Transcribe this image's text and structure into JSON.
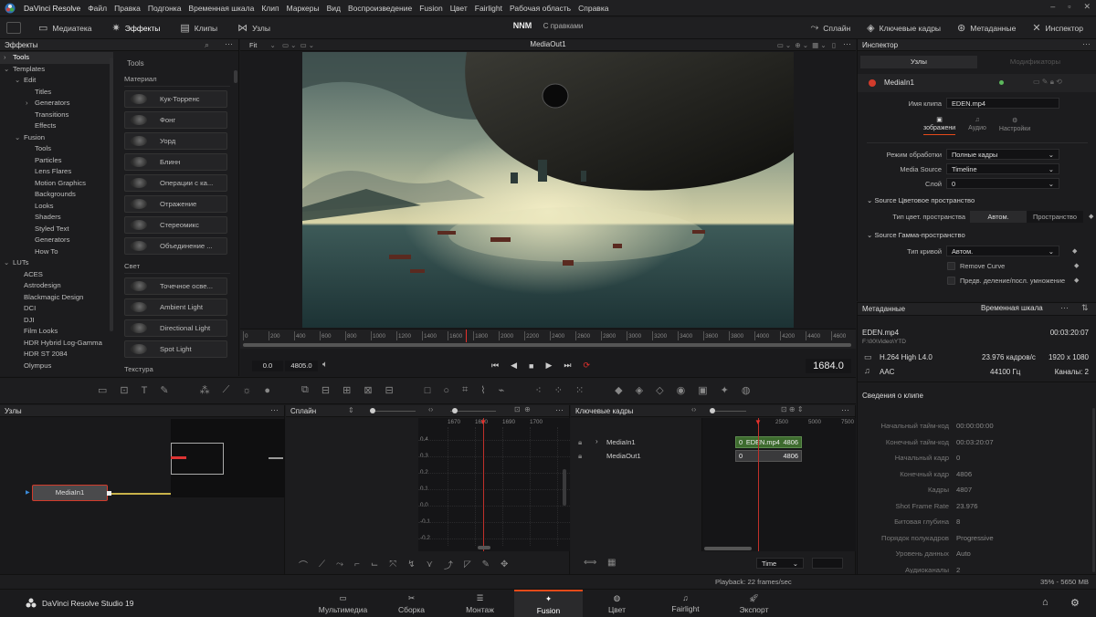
{
  "app": {
    "title": "DaVinci Resolve",
    "logo_icon": "davinci-logo-icon"
  },
  "menu": [
    "Файл",
    "Правка",
    "Подгонка",
    "Временная шкала",
    "Клип",
    "Маркеры",
    "Вид",
    "Воспроизведение",
    "Fusion",
    "Цвет",
    "Fairlight",
    "Рабочая область",
    "Справка"
  ],
  "toolbar": {
    "left": [
      {
        "label": "Медиатека",
        "icon": "media-pool-icon"
      },
      {
        "label": "Эффекты",
        "icon": "effects-icon"
      },
      {
        "label": "Клипы",
        "icon": "clips-icon"
      },
      {
        "label": "Узлы",
        "icon": "nodes-icon"
      }
    ],
    "project_title": "NNM",
    "project_subtitle": "С правками",
    "right": [
      {
        "label": "Сплайн",
        "icon": "spline-icon"
      },
      {
        "label": "Ключевые кадры",
        "icon": "keyframes-icon"
      },
      {
        "label": "Метаданные",
        "icon": "metadata-icon"
      },
      {
        "label": "Инспектор",
        "icon": "inspector-icon"
      }
    ]
  },
  "effects": {
    "header": "Эффекты",
    "tree": [
      {
        "label": "Tools",
        "level": 0,
        "arrow": "›",
        "selected": true
      },
      {
        "label": "Templates",
        "level": 0,
        "arrow": "⌄"
      },
      {
        "label": "Edit",
        "level": 1,
        "arrow": "⌄"
      },
      {
        "label": "Titles",
        "level": 2
      },
      {
        "label": "Generators",
        "level": 2,
        "arrow": "›"
      },
      {
        "label": "Transitions",
        "level": 2
      },
      {
        "label": "Effects",
        "level": 2
      },
      {
        "label": "Fusion",
        "level": 1,
        "arrow": "⌄"
      },
      {
        "label": "Tools",
        "level": 2
      },
      {
        "label": "Particles",
        "level": 2
      },
      {
        "label": "Lens Flares",
        "level": 2
      },
      {
        "label": "Motion Graphics",
        "level": 2
      },
      {
        "label": "Backgrounds",
        "level": 2
      },
      {
        "label": "Looks",
        "level": 2
      },
      {
        "label": "Shaders",
        "level": 2
      },
      {
        "label": "Styled Text",
        "level": 2
      },
      {
        "label": "Generators",
        "level": 2
      },
      {
        "label": "How To",
        "level": 2
      },
      {
        "label": "LUTs",
        "level": 0,
        "arrow": "⌄"
      },
      {
        "label": "ACES",
        "level": 1
      },
      {
        "label": "Astrodesign",
        "level": 1
      },
      {
        "label": "Blackmagic Design",
        "level": 1
      },
      {
        "label": "DCI",
        "level": 1
      },
      {
        "label": "DJI",
        "level": 1
      },
      {
        "label": "Film Looks",
        "level": 1
      },
      {
        "label": "HDR Hybrid Log-Gamma",
        "level": 1
      },
      {
        "label": "HDR ST 2084",
        "level": 1
      },
      {
        "label": "Olympus",
        "level": 1
      }
    ],
    "list_title": "Tools",
    "sections": [
      {
        "title": "Материал",
        "items": [
          "Кук-Торренс",
          "Фонг",
          "Уорд",
          "Блинн",
          "Операции с ка...",
          "Отражение",
          "Стереомикс",
          "Объединение ..."
        ]
      },
      {
        "title": "Свет",
        "items": [
          "Точечное осве...",
          "Ambient Light",
          "Directional Light",
          "Spot Light"
        ]
      }
    ],
    "cut_section": "Текстура"
  },
  "viewer": {
    "zoom": "Fit",
    "title": "MediaOut1",
    "ruler_ticks": [
      "0",
      "200",
      "400",
      "600",
      "800",
      "1000",
      "1200",
      "1400",
      "1600",
      "1800",
      "2000",
      "2200",
      "2400",
      "2600",
      "2800",
      "3000",
      "3200",
      "3400",
      "3600",
      "3800",
      "4000",
      "4200",
      "4400",
      "4600"
    ],
    "in_point": "0.0",
    "out_point": "4805.0",
    "current_frame": "1684.0",
    "playhead_fraction": 0.365
  },
  "inspector": {
    "header": "Инспектор",
    "tabs": [
      "Узлы",
      "Модификаторы"
    ],
    "node_name": "MediaIn1",
    "clip_name_label": "Имя клипа",
    "clip_name": "EDEN.mp4",
    "subtabs": [
      {
        "label": "зображени",
        "icon": "image-icon",
        "active": true
      },
      {
        "label": "Аудио",
        "icon": "audio-icon"
      },
      {
        "label": "Настройки",
        "icon": "settings-icon"
      }
    ],
    "fields": [
      {
        "label": "Режим обработки",
        "value": "Полные кадры"
      },
      {
        "label": "Media Source",
        "value": "Timeline"
      },
      {
        "label": "Слой",
        "value": "0"
      }
    ],
    "source_color_space": {
      "title": "Source Цветовое пространство",
      "label": "Тип цвет. пространства",
      "option1": "Автом.",
      "option2": "Пространство"
    },
    "source_gamma": {
      "title": "Source Гамма-пространство",
      "curve_label": "Тип кривой",
      "curve_value": "Автом.",
      "remove_curve": "Remove Curve",
      "pre_divide": "Предв. деление/посл. умножение"
    }
  },
  "metadata": {
    "header": "Метаданные",
    "sub_header": "Временная шкала",
    "file_name": "EDEN.mp4",
    "duration": "00:03:20:07",
    "path": "F:\\00\\Video\\YTD",
    "codec": "H.264 High L4.0",
    "fps": "23.976 кадров/с",
    "resolution": "1920 x 1080",
    "audio_codec": "AAC",
    "sample_rate": "44100 Гц",
    "channels": "Каналы: 2",
    "clip_info_title": "Сведения о клипе",
    "rows": [
      {
        "k": "Начальный тайм-код",
        "v": "00:00:00:00"
      },
      {
        "k": "Конечный тайм-код",
        "v": "00:03:20:07"
      },
      {
        "k": "Начальный кадр",
        "v": "0"
      },
      {
        "k": "Конечный кадр",
        "v": "4806"
      },
      {
        "k": "Кадры",
        "v": "4807"
      },
      {
        "k": "Shot Frame Rate",
        "v": "23.976"
      },
      {
        "k": "Битовая глубина",
        "v": "8"
      },
      {
        "k": "Порядок полукадров",
        "v": "Progressive"
      },
      {
        "k": "Уровень данных",
        "v": "Auto"
      },
      {
        "k": "Аудиоканалы",
        "v": "2"
      }
    ]
  },
  "nodes": {
    "header": "Узлы",
    "node_label": "MediaIn1"
  },
  "spline": {
    "header": "Сплайн",
    "ticks": [
      "1670",
      "1680",
      "1690",
      "1700"
    ],
    "y_ticks": [
      "0.4",
      "0.3",
      "0.2",
      "0.1",
      "0.0",
      "-0.1",
      "-0.2"
    ]
  },
  "keyframes": {
    "header": "Ключевые кадры",
    "ticks": [
      "2500",
      "5000",
      "7500"
    ],
    "tracks": [
      "MediaIn1",
      "MediaOut1"
    ],
    "bar1_start": "0",
    "bar1_label": "EDEN.mp4",
    "bar1_end": "4806",
    "bar2_start": "0",
    "bar2_end": "4806",
    "time_dropdown": "Time"
  },
  "status": {
    "playback": "Playback: 22 frames/sec",
    "memory": "35% - 5650 MB"
  },
  "bottom": {
    "brand": "DaVinci Resolve Studio 19",
    "pages": [
      {
        "label": "Мультимедиа",
        "icon": "media-page-icon"
      },
      {
        "label": "Сборка",
        "icon": "cut-page-icon"
      },
      {
        "label": "Монтаж",
        "icon": "edit-page-icon"
      },
      {
        "label": "Fusion",
        "icon": "fusion-page-icon",
        "active": true
      },
      {
        "label": "Цвет",
        "icon": "color-page-icon"
      },
      {
        "label": "Fairlight",
        "icon": "fairlight-page-icon"
      },
      {
        "label": "Экспорт",
        "icon": "deliver-page-icon"
      }
    ]
  },
  "colors": {
    "accent": "#e64a19",
    "playhead": "#e5312c",
    "bg": "#1b1b1d",
    "green": "#3d6b2e"
  }
}
